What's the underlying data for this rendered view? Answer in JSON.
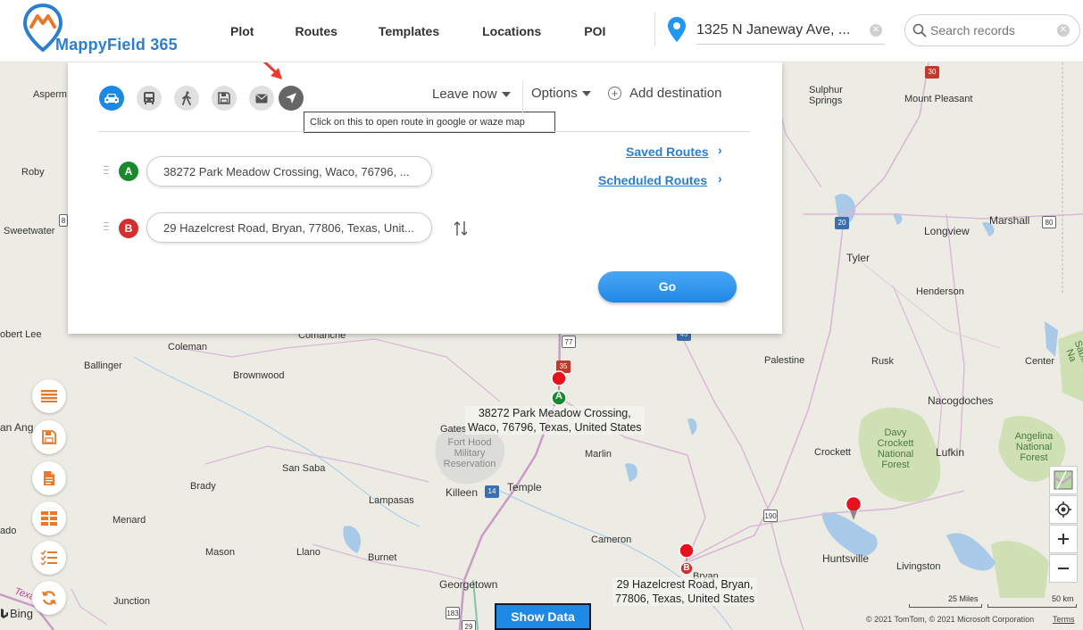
{
  "app": {
    "logo_text": "MappyField 365"
  },
  "nav": [
    "Plot",
    "Routes",
    "Templates",
    "Locations",
    "POI"
  ],
  "location_bar": {
    "value": "1325 N Janeway Ave, ..."
  },
  "search": {
    "placeholder": "Search records"
  },
  "panel": {
    "tooltip": "Click on this to open route in google or waze map",
    "leave_now": "Leave now",
    "options": "Options",
    "add_destination": "Add destination",
    "origin": {
      "marker": "A",
      "address": "38272 Park Meadow Crossing, Waco, 76796, ..."
    },
    "destination": {
      "marker": "B",
      "address": "29 Hazelcrest Road, Bryan, 77806, Texas, Unit..."
    },
    "saved_routes": "Saved Routes",
    "scheduled_routes": "Scheduled Routes",
    "go": "Go"
  },
  "map": {
    "places": [
      "Asperm",
      "Roby",
      "Sweetwater",
      "obert Lee",
      "Ballinger",
      "Coleman",
      "Comanche",
      "Brownwood",
      "an Ang",
      "Gates",
      "Waco",
      "Marlin",
      "San Saba",
      "Brady",
      "Lampasas",
      "Killeen",
      "Temple",
      "Menard",
      "Mason",
      "Llano",
      "Burnet",
      "Georgetown",
      "Junction",
      "ado",
      "Cameron",
      "Bryan",
      "Huntsville",
      "Livingston",
      "Crockett",
      "Lufkin",
      "Nacogdoches",
      "Palestine",
      "Rusk",
      "Center",
      "Henderson",
      "Tyler",
      "Longview",
      "Marshall",
      "Sulphur Springs",
      "Mount Pleasant"
    ],
    "forest_labels": [
      "Davy Crockett National Forest",
      "Angelina National Forest",
      "Sabine Na"
    ],
    "fort_label": "Fort Hood Military Reservation",
    "pin_a_label": [
      "38272 Park Meadow Crossing,",
      "Waco, 76796, Texas, United States"
    ],
    "pin_b_label": [
      "29 Hazelcrest Road, Bryan,",
      "77806, Texas, United States"
    ],
    "pin_marker_a": "A",
    "pin_marker_b": "B",
    "shields": [
      "77",
      "35",
      "14",
      "190",
      "20",
      "45",
      "30",
      "80",
      "183",
      "29",
      "8"
    ],
    "scale_25": "25 Miles",
    "scale_50": "50 km",
    "copyright": "© 2021 TomTom, © 2021 Microsoft Corporation",
    "terms": "Terms",
    "bing": "Bing",
    "road_label": "Texa"
  },
  "show_data": "Show Data",
  "colors": {
    "brand": "#1e88e5",
    "marker_a": "#198a2b",
    "marker_b": "#d32f2f",
    "accent_orange": "#e8782a"
  }
}
